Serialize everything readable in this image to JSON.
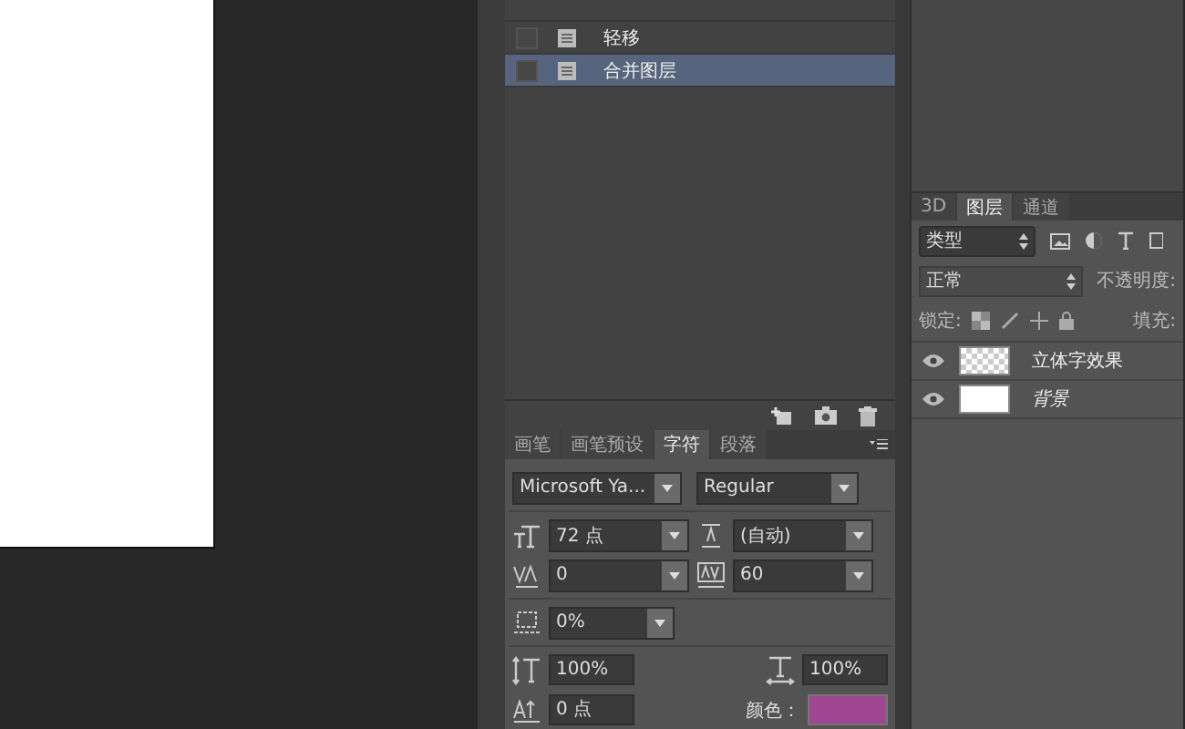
{
  "history": {
    "rows": [
      {
        "label": "轻移",
        "selected": false
      },
      {
        "label": "合并图层",
        "selected": true
      }
    ]
  },
  "character_panel": {
    "tabs": [
      {
        "label": "画笔",
        "selected": false
      },
      {
        "label": "画笔预设",
        "selected": false
      },
      {
        "label": "字符",
        "selected": true
      },
      {
        "label": "段落",
        "selected": false
      }
    ],
    "font_family": "Microsoft Ya...",
    "font_style": "Regular",
    "font_size": "72 点",
    "leading": "(自动)",
    "kerning": "0",
    "tracking": "60",
    "tsume": "0%",
    "vertical_scale": "100%",
    "horizontal_scale": "100%",
    "baseline_shift": "0 点",
    "color_label": "颜色：",
    "color": "#9e4690"
  },
  "layers_panel": {
    "tabs": [
      {
        "label": "3D",
        "selected": false
      },
      {
        "label": "图层",
        "selected": true
      },
      {
        "label": "通道",
        "selected": false
      }
    ],
    "filter": "类型",
    "blend_mode": "正常",
    "opacity_label": "不透明度:",
    "lock_label": "锁定:",
    "fill_label": "填充:",
    "layers": [
      {
        "name": "立体字效果",
        "kind": "transparent",
        "visible": true
      },
      {
        "name": "背景",
        "kind": "background",
        "visible": true
      }
    ]
  }
}
